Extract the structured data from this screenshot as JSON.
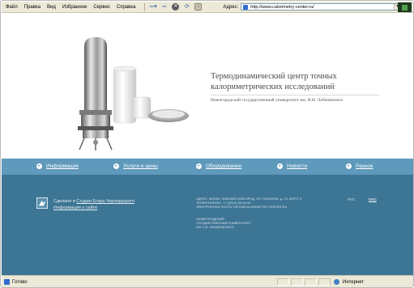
{
  "browser": {
    "menu": [
      "Файл",
      "Правка",
      "Вид",
      "Избранное",
      "Сервис",
      "Справка"
    ],
    "nav_icons": [
      "back-arrow-icon",
      "forward-arrow-icon",
      "stop-icon",
      "refresh-icon",
      "home-icon"
    ],
    "address_label": "Адрес:",
    "url": "http://www.calorimetry-center.ru/"
  },
  "hero": {
    "title": "Термодинамический центр точных калориметрических исследований",
    "subtitle": "Нижегородский государственный университет им. Н.И. Лобачевского"
  },
  "nav": {
    "items": [
      "Информация",
      "Услуги и цены",
      "Оборудование",
      "Новости",
      "Разное"
    ]
  },
  "footer": {
    "studio_prefix": "Сделано в",
    "studio_link": "Студии Егора Черноруцкого",
    "about_link": "Информация о сайте",
    "address_lines": [
      "АДРЕС: 603950, НИЖНИЙ НОВГОРОД, ПР. ГАГАРИНА, д. 23, КОРП. 5",
      "ТЕЛЕФОН/ФАКС: +7 (8312) 65-64-50",
      "ЭЛЕКТРОННАЯ ПОЧТА: INFO@CALORIMETRY-CENTER.RU"
    ],
    "org_lines": [
      "НИЖЕГОРОДСКИЙ",
      "ГОСУДАРСТВЕННЫЙ УНИВЕРСИТЕТ",
      "ИМ. Н.И. ЛОБАЧЕВСКОГО"
    ],
    "lang_ru": "РУС",
    "lang_en": "ENG"
  },
  "status": {
    "text": "Готово",
    "zone": "Интернет"
  },
  "colors": {
    "nav_band": "#5f99bb",
    "footer_bg": "#3d7594",
    "chrome": "#ece9d8"
  }
}
